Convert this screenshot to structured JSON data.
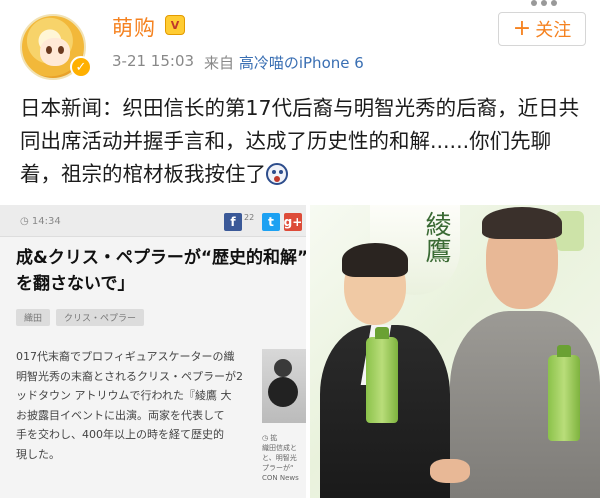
{
  "author": {
    "name": "萌购",
    "vip_badge": "V"
  },
  "post_meta": {
    "timestamp": "3-21 15:03",
    "source_prefix": "来自",
    "device": "高冷喵のiPhone 6"
  },
  "follow_button": {
    "icon": "+",
    "label": "关注"
  },
  "post": {
    "text": "日本新闻：织田信长的第17代后裔与明智光秀的后裔，近日共同出席活动并握手言和，达成了历史性的和解......你们先聊着，祖宗的棺材板我按住了"
  },
  "images": {
    "news_screenshot": {
      "time": "◷ 14:34",
      "share_count": "22",
      "share_buttons": [
        "f",
        "t",
        "g+"
      ],
      "headline_line1": "成&クリス・ペプラーが“歴史的和解”",
      "headline_line2": "を翻さないで」",
      "tags": [
        "織田",
        "クリス・ペプラー"
      ],
      "body_lines": [
        "017代末裔でプロフィギュアスケーターの織",
        "明智光秀の末裔とされるクリス・ペプラーが2",
        "ッドタウン アトリウムで行われた『綾鷹 大",
        "お披露目イベントに出演。両家を代表して",
        "手を交わし、400年以上の時を経て歴史的",
        "現した。"
      ],
      "thumb_caption": [
        "◷ 拡",
        "織田信成と",
        "と、明智光",
        "プラーが“",
        "CON News"
      ],
      "source": "CON News"
    },
    "event_photo": {
      "banner_text": "綾鷹"
    }
  },
  "colors": {
    "accent": "#f58220",
    "link": "#3a6fb3",
    "meta_gray": "#888888"
  }
}
